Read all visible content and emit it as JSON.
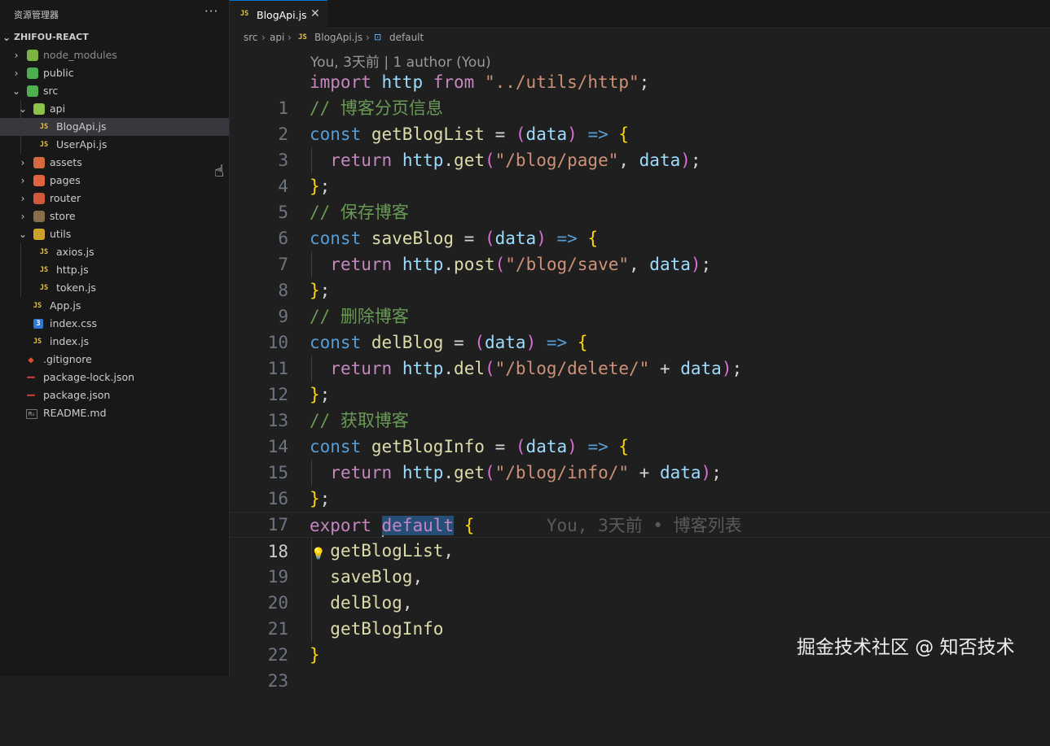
{
  "explorer": {
    "title": "资源管理器",
    "more": "···",
    "root": "ZHIFOU-REACT",
    "items": [
      {
        "label": "node_modules",
        "icon": "node-folder-icon"
      },
      {
        "label": "public",
        "icon": "public-folder-icon"
      },
      {
        "label": "src",
        "icon": "src-folder-icon"
      },
      {
        "label": "api",
        "icon": "api-folder-icon"
      },
      {
        "label": "BlogApi.js",
        "icon": "js-file-icon",
        "icon_text": "JS"
      },
      {
        "label": "UserApi.js",
        "icon": "js-file-icon",
        "icon_text": "JS"
      },
      {
        "label": "assets",
        "icon": "assets-folder-icon"
      },
      {
        "label": "pages",
        "icon": "pages-folder-icon"
      },
      {
        "label": "router",
        "icon": "router-folder-icon"
      },
      {
        "label": "store",
        "icon": "store-folder-icon"
      },
      {
        "label": "utils",
        "icon": "utils-folder-icon"
      },
      {
        "label": "axios.js",
        "icon": "js-file-icon",
        "icon_text": "JS"
      },
      {
        "label": "http.js",
        "icon": "js-file-icon",
        "icon_text": "JS"
      },
      {
        "label": "token.js",
        "icon": "js-file-icon",
        "icon_text": "JS"
      },
      {
        "label": "App.js",
        "icon": "js-file-icon",
        "icon_text": "JS"
      },
      {
        "label": "index.css",
        "icon": "css-file-icon",
        "icon_text": "3"
      },
      {
        "label": "index.js",
        "icon": "js-file-icon",
        "icon_text": "JS"
      },
      {
        "label": ".gitignore",
        "icon": "git-file-icon"
      },
      {
        "label": "package-lock.json",
        "icon": "json-file-icon"
      },
      {
        "label": "package.json",
        "icon": "json-file-icon"
      },
      {
        "label": "README.md",
        "icon": "markdown-file-icon",
        "icon_text": "M↓"
      }
    ],
    "selected": "BlogApi.js"
  },
  "tab": {
    "icon_text": "JS",
    "label": "BlogApi.js",
    "close": "✕"
  },
  "breadcrumb": {
    "parts": [
      "src",
      "api",
      "BlogApi.js",
      "default"
    ],
    "separator": "›",
    "js_icon_text": "JS",
    "symbol_icon": "symbol-variable-icon"
  },
  "blame_header": "You, 3天前 | 1 author (You)",
  "editor": {
    "active_line": 18,
    "inline_blame": "You, 3天前 • 博客列表",
    "line_numbers": [
      "1",
      "2",
      "3",
      "4",
      "5",
      "6",
      "7",
      "8",
      "9",
      "10",
      "11",
      "12",
      "13",
      "14",
      "15",
      "16",
      "17",
      "18",
      "19",
      "20",
      "21",
      "22",
      "23"
    ]
  },
  "code_tokens": {
    "l1": [
      "import",
      " ",
      "http",
      " ",
      "from",
      " ",
      "\"../utils/http\"",
      ";"
    ],
    "l2": [
      "// 博客分页信息"
    ],
    "l3": [
      "const",
      " ",
      "getBlogList",
      " = ",
      "(",
      "data",
      ")",
      " ",
      "=>",
      " ",
      "{"
    ],
    "l4": [
      "  ",
      "return",
      " ",
      "http",
      ".",
      "get",
      "(",
      "\"/blog/page\"",
      ", ",
      "data",
      ")",
      ";"
    ],
    "l5": [
      "}",
      ";"
    ],
    "l6": [
      "// 保存博客"
    ],
    "l7": [
      "const",
      " ",
      "saveBlog",
      " = ",
      "(",
      "data",
      ")",
      " ",
      "=>",
      " ",
      "{"
    ],
    "l8": [
      "  ",
      "return",
      " ",
      "http",
      ".",
      "post",
      "(",
      "\"/blog/save\"",
      ", ",
      "data",
      ")",
      ";"
    ],
    "l9": [
      "}",
      ";"
    ],
    "l10": [
      "// 删除博客"
    ],
    "l11": [
      "const",
      " ",
      "delBlog",
      " = ",
      "(",
      "data",
      ")",
      " ",
      "=>",
      " ",
      "{"
    ],
    "l12": [
      "  ",
      "return",
      " ",
      "http",
      ".",
      "del",
      "(",
      "\"/blog/delete/\"",
      " + ",
      "data",
      ")",
      ";"
    ],
    "l13": [
      "}",
      ";"
    ],
    "l14": [
      "// 获取博客"
    ],
    "l15": [
      "const",
      " ",
      "getBlogInfo",
      " = ",
      "(",
      "data",
      ")",
      " ",
      "=>",
      " ",
      "{"
    ],
    "l16": [
      "  ",
      "return",
      " ",
      "http",
      ".",
      "get",
      "(",
      "\"/blog/info/\"",
      " + ",
      "data",
      ")",
      ";"
    ],
    "l17": [
      "}",
      ";"
    ],
    "l18": [
      "export",
      " ",
      "default",
      " ",
      "{"
    ],
    "l19": [
      "  ",
      "getBlogList",
      ","
    ],
    "l20": [
      "  ",
      "saveBlog",
      ","
    ],
    "l21": [
      "  ",
      "delBlog",
      ","
    ],
    "l22": [
      "  ",
      "getBlogInfo"
    ],
    "l23": [
      "}"
    ]
  },
  "watermark": "掘金技术社区 @ 知否技术",
  "colors": {
    "keyword": "#569cd6",
    "control_keyword": "#c586c0",
    "identifier": "#9cdcfe",
    "function": "#dcdcaa",
    "string": "#ce9178",
    "comment": "#6a9955",
    "bracket": "#ffd700",
    "bracket_nested": "#da70d6",
    "accent": "#0078d4",
    "js_icon": "#e8c547"
  }
}
